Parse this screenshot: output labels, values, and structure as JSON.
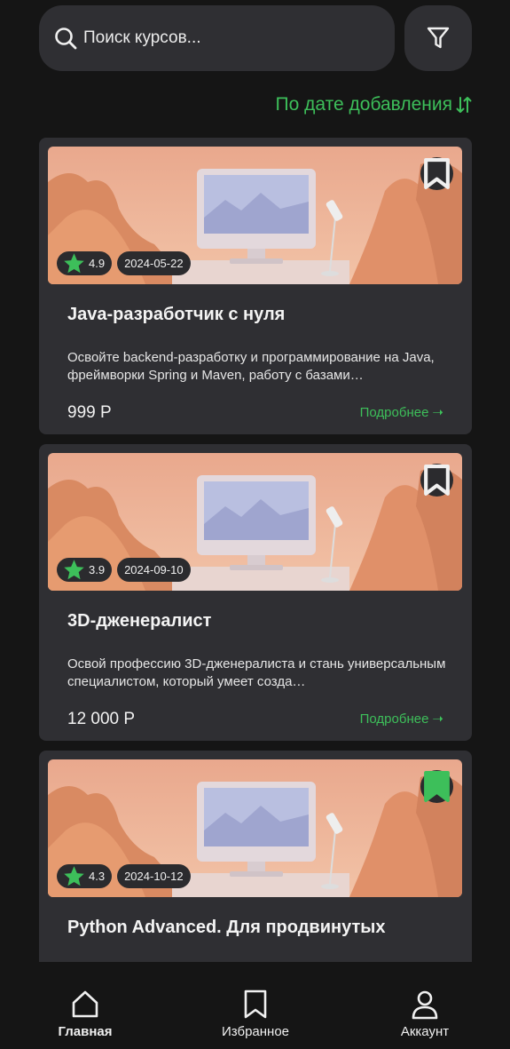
{
  "search": {
    "placeholder": "Поиск курсов..."
  },
  "sort": {
    "label": "По дате добавления"
  },
  "courses": [
    {
      "rating": "4.9",
      "date": "2024-05-22",
      "title": "Java-разработчик с нуля",
      "description": "Освойте backend-разработку и программирование на Java, фреймворки Spring и Maven, работу с базами…",
      "price": "999 Р",
      "more": "Подробнее",
      "bookmarked": false
    },
    {
      "rating": "3.9",
      "date": "2024-09-10",
      "title": "3D-дженералист",
      "description": "Освой профессию 3D-дженералиста и стань универсальным специалистом, который умеет созда…",
      "price": "12 000 Р",
      "more": "Подробнее",
      "bookmarked": false
    },
    {
      "rating": "4.3",
      "date": "2024-10-12",
      "title": "Python Advanced. Для продвинутых",
      "description": "",
      "price": "",
      "more": "",
      "bookmarked": true
    }
  ],
  "nav": {
    "items": [
      {
        "label": "Главная",
        "icon": "home-icon",
        "active": true
      },
      {
        "label": "Избранное",
        "icon": "bookmark-icon",
        "active": false
      },
      {
        "label": "Аккаунт",
        "icon": "user-icon",
        "active": false
      }
    ]
  },
  "colors": {
    "accent": "#3dbf5a",
    "card": "#2f2f33",
    "background": "#151515"
  }
}
